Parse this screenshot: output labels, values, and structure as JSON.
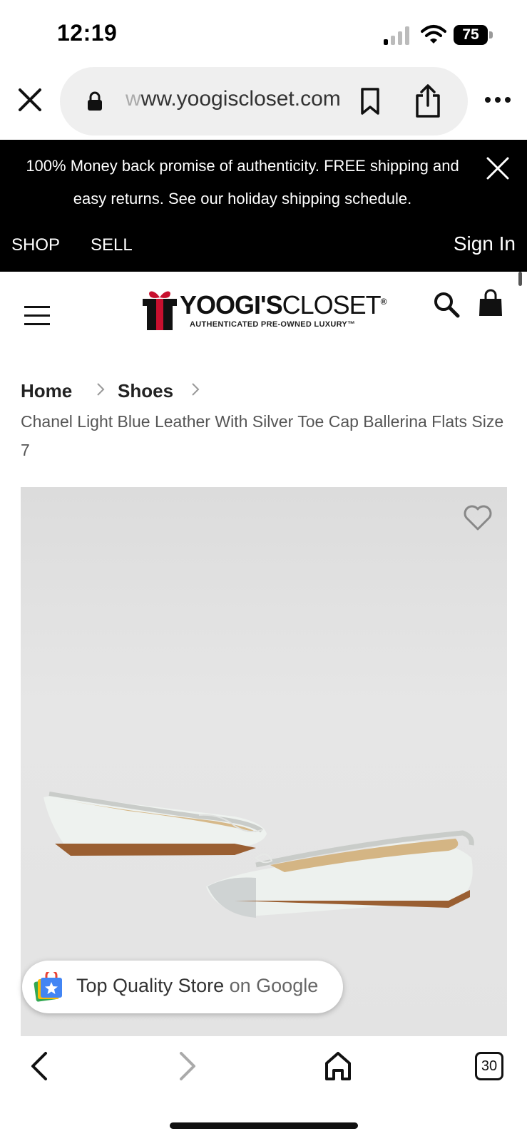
{
  "status_bar": {
    "time": "12:19",
    "battery": "75"
  },
  "browser": {
    "url_faded": "w",
    "url": "ww.yoogiscloset.com"
  },
  "promo": {
    "text": "100% Money back promise of authenticity. FREE shipping and easy returns. See our holiday shipping schedule.",
    "nav": {
      "shop": "SHOP",
      "sell": "SELL",
      "sign_in": "Sign In"
    }
  },
  "logo": {
    "title_bold": "YOOGI'S",
    "title_light": "CLOSET",
    "trademark": "®",
    "subtitle": "AUTHENTICATED PRE-OWNED LUXURY™"
  },
  "breadcrumb": {
    "home": "Home",
    "shoes": "Shoes"
  },
  "product": {
    "title": "Chanel Light Blue Leather With Silver Toe Cap Ballerina Flats Size 7"
  },
  "google_badge": {
    "label": "Top Quality Store",
    "suffix": "on Google"
  },
  "bottom_bar": {
    "tabs_count": "30"
  },
  "colors": {
    "banner": "#000000",
    "logo_red": "#c8102e",
    "accent_text": "#222222"
  }
}
